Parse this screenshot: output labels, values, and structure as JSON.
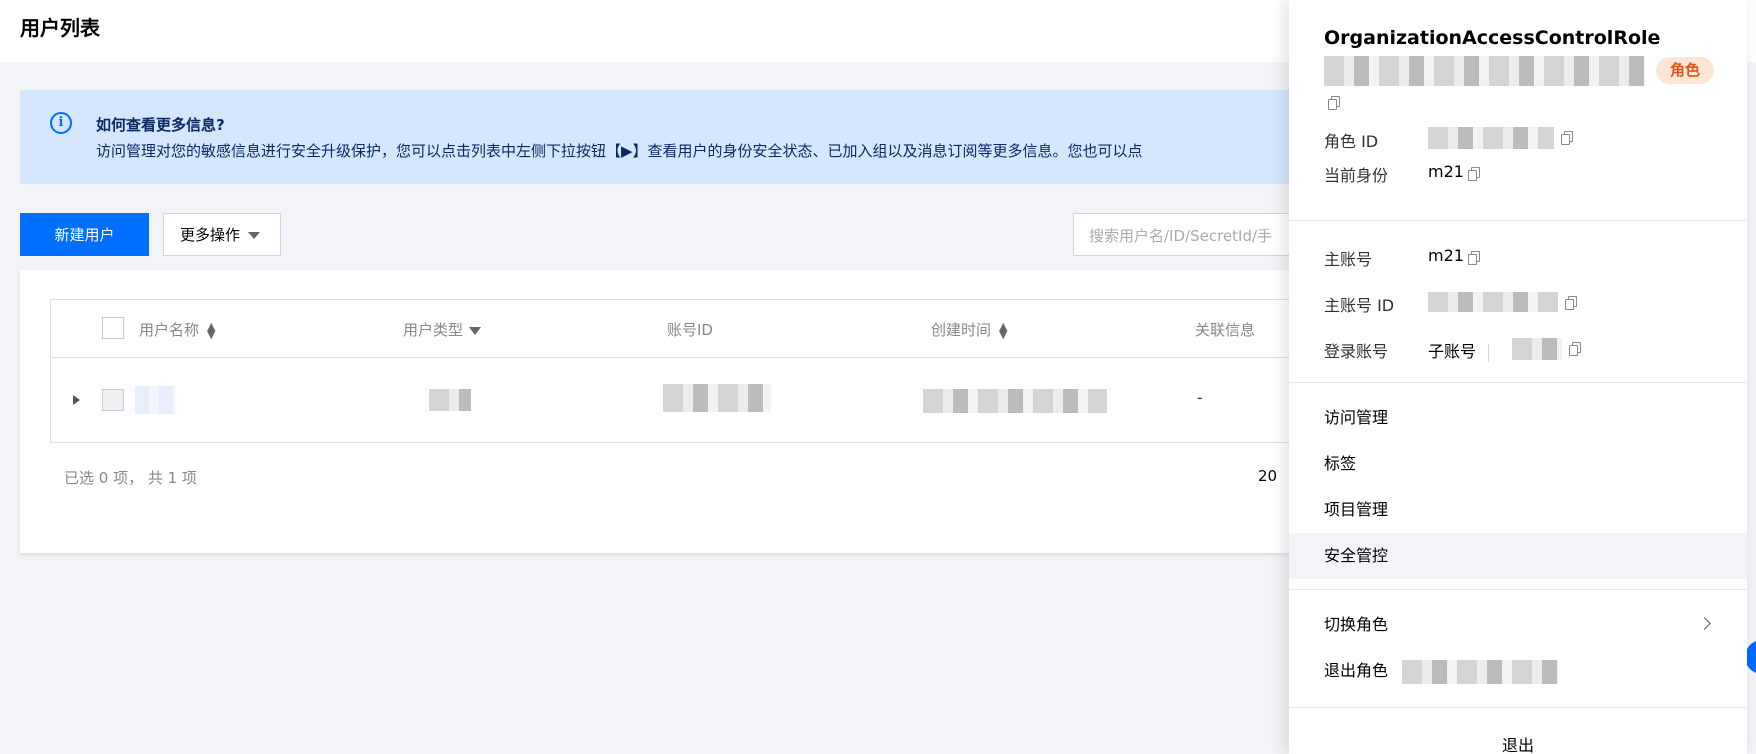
{
  "page": {
    "title": "用户列表"
  },
  "info": {
    "title": "如何查看更多信息?",
    "text": "访问管理对您的敏感信息进行安全升级保护，您可以点击列表中左侧下拉按钮【▶】查看用户的身份安全状态、已加入组以及消息订阅等更多信息。您也可以点"
  },
  "toolbar": {
    "new_user": "新建用户",
    "more_actions": "更多操作",
    "search_placeholder": "搜索用户名/ID/SecretId/手"
  },
  "table": {
    "columns": [
      "用户名称",
      "用户类型",
      "账号ID",
      "创建时间",
      "关联信息"
    ],
    "rows": [
      {
        "linked_info": "-"
      }
    ]
  },
  "footer": {
    "summary": "已选 0 项， 共 1 项",
    "page_size": "20"
  },
  "menu": {
    "role_name": "OrganizationAccessControlRole",
    "role_badge": "角色",
    "role_id_label": "角色 ID",
    "current_identity_label": "当前身份",
    "current_identity_value": "m21",
    "main_account_label": "主账号",
    "main_account_value": "m21",
    "main_account_id_label": "主账号 ID",
    "login_account_label": "登录账号",
    "login_account_value": "子账号",
    "items": [
      "访问管理",
      "标签",
      "项目管理",
      "安全管控"
    ],
    "switch_role": "切换角色",
    "exit_role": "退出角色",
    "logout": "退出"
  },
  "colors": {
    "primary": "#006eff",
    "banner_bg": "#d5e7ff",
    "badge_text": "#e0531c",
    "badge_bg": "#fde6d6"
  }
}
